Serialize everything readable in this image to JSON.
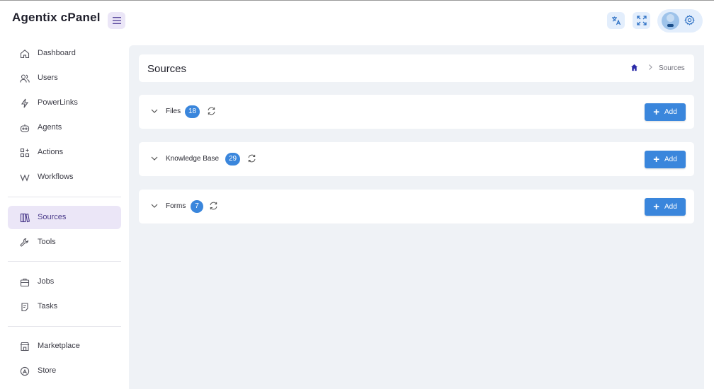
{
  "app": {
    "title": "Agentix cPanel"
  },
  "colors": {
    "accent": "#3a86dc",
    "active_bg": "#ebe6f7",
    "content_bg": "#eff2f6",
    "home_icon": "#2a2aa8"
  },
  "topbar": {
    "icons": [
      "menu-icon",
      "translate-icon",
      "fullscreen-icon",
      "avatar",
      "gear-icon"
    ]
  },
  "sidebar": {
    "items": [
      {
        "label": "Dashboard",
        "icon": "home-icon"
      },
      {
        "label": "Users",
        "icon": "users-icon"
      },
      {
        "label": "PowerLinks",
        "icon": "lightning-icon"
      },
      {
        "label": "Agents",
        "icon": "robot-icon"
      },
      {
        "label": "Actions",
        "icon": "grid-icon"
      },
      {
        "label": "Workflows",
        "icon": "workflow-icon"
      },
      {
        "label": "Sources",
        "icon": "books-icon",
        "active": true
      },
      {
        "label": "Tools",
        "icon": "wrench-icon"
      },
      {
        "label": "Jobs",
        "icon": "briefcase-icon"
      },
      {
        "label": "Tasks",
        "icon": "clipboard-icon"
      },
      {
        "label": "Marketplace",
        "icon": "store-icon"
      },
      {
        "label": "Store",
        "icon": "store-badge-icon"
      }
    ]
  },
  "header": {
    "title": "Sources",
    "breadcrumb": {
      "home_icon": "home-icon",
      "current": "Sources"
    }
  },
  "sections": [
    {
      "title": "Files",
      "count": "18",
      "add_label": "Add"
    },
    {
      "title": "Knowledge Base",
      "count": "29",
      "add_label": "Add"
    },
    {
      "title": "Forms",
      "count": "7",
      "add_label": "Add"
    }
  ]
}
